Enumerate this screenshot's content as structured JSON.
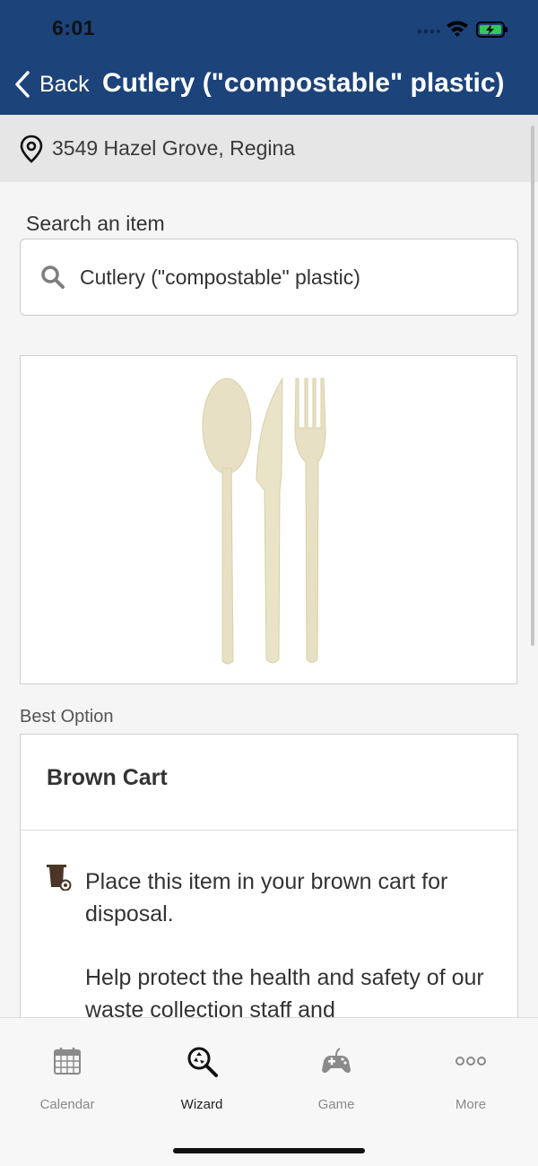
{
  "status_bar": {
    "time": "6:01"
  },
  "nav": {
    "back_label": "Back",
    "title": "Cutlery (\"compostable\" plastic)"
  },
  "location": {
    "address": "3549 Hazel Grove, Regina",
    "icon": "map-pin-icon"
  },
  "search": {
    "label": "Search an item",
    "value": "Cutlery (\"compostable\" plastic)",
    "icon": "search-icon"
  },
  "item_image": {
    "icon": "cutlery-icon"
  },
  "best_option": {
    "section_label": "Best Option",
    "title": "Brown Cart",
    "icon": "brown-cart-icon",
    "paragraphs": [
      "Place this item in your brown cart for disposal.",
      "Help protect the health and safety of our waste collection staff and"
    ]
  },
  "tabs": [
    {
      "label": "Calendar",
      "icon": "calendar-icon",
      "active": false
    },
    {
      "label": "Wizard",
      "icon": "wizard-search-icon",
      "active": true
    },
    {
      "label": "Game",
      "icon": "game-controller-icon",
      "active": false
    },
    {
      "label": "More",
      "icon": "more-icon",
      "active": false
    }
  ],
  "colors": {
    "header": "#1c437a",
    "brown_cart": "#4a3526",
    "battery": "#34c759"
  }
}
